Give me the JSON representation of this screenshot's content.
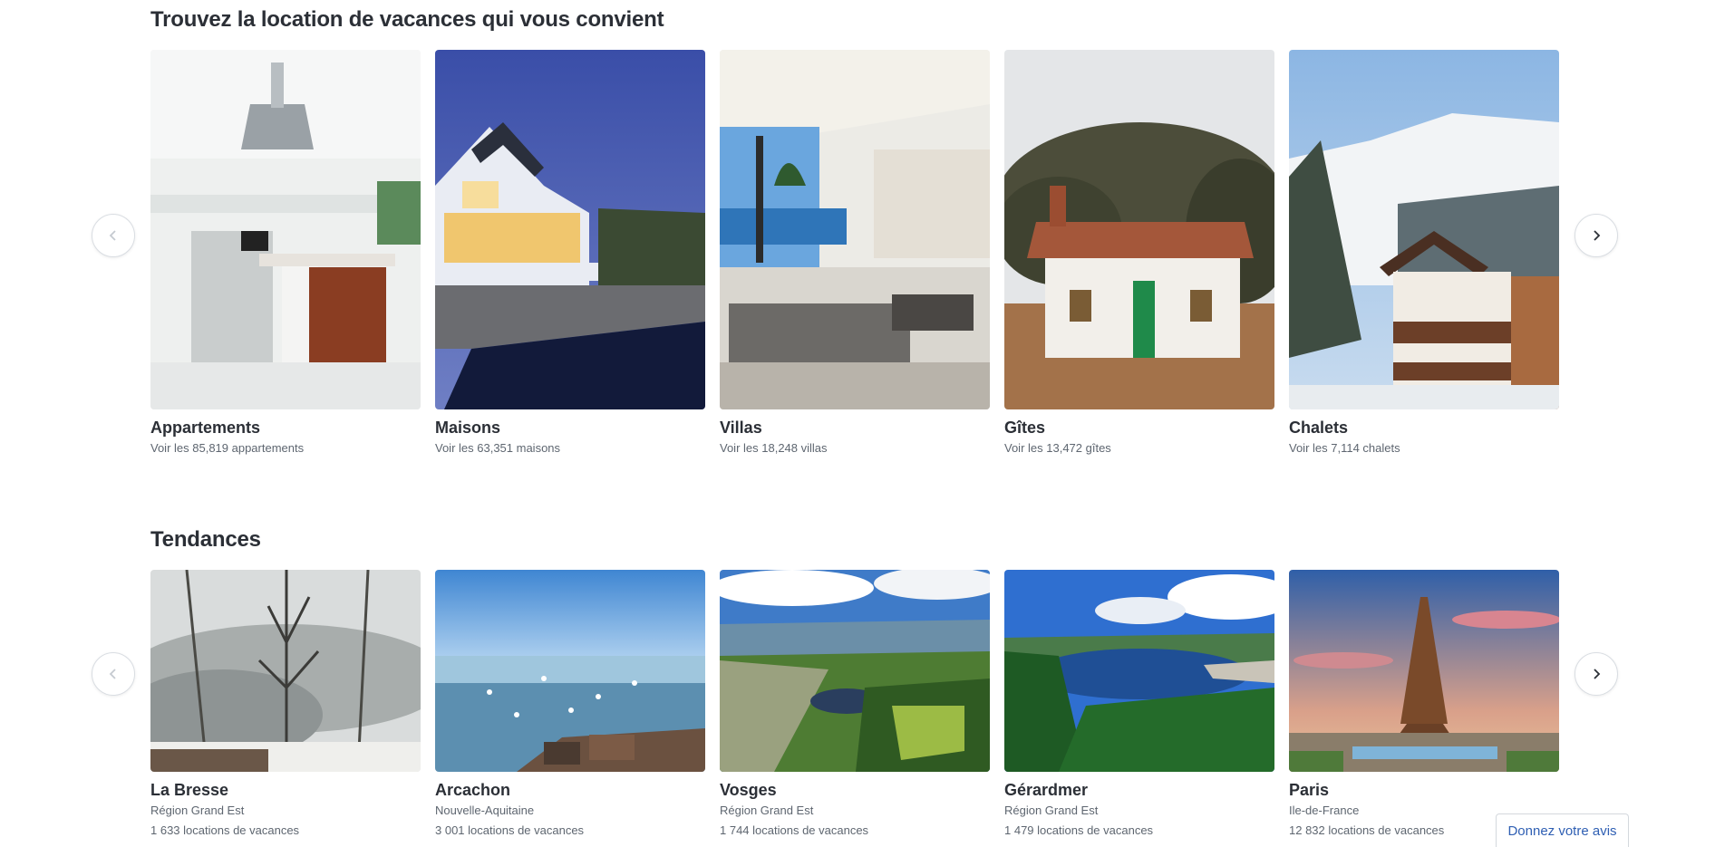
{
  "types_section": {
    "title": "Trouvez la location de vacances qui vous convient",
    "cards": [
      {
        "name": "Appartements",
        "sub": "Voir les 85,819 appartements"
      },
      {
        "name": "Maisons",
        "sub": "Voir les 63,351 maisons"
      },
      {
        "name": "Villas",
        "sub": "Voir les 18,248 villas"
      },
      {
        "name": "Gîtes",
        "sub": "Voir les 13,472 gîtes"
      },
      {
        "name": "Chalets",
        "sub": "Voir les 7,114 chalets"
      }
    ]
  },
  "trending_section": {
    "title": "Tendances",
    "cards": [
      {
        "name": "La Bresse",
        "region": "Région Grand Est",
        "count": "1 633 locations de vacances"
      },
      {
        "name": "Arcachon",
        "region": "Nouvelle-Aquitaine",
        "count": "3 001 locations de vacances"
      },
      {
        "name": "Vosges",
        "region": "Région Grand Est",
        "count": "1 744 locations de vacances"
      },
      {
        "name": "Gérardmer",
        "region": "Région Grand Est",
        "count": "1 479 locations de vacances"
      },
      {
        "name": "Paris",
        "region": "Ile-de-France",
        "count": "12 832 locations de vacances"
      }
    ]
  },
  "feedback": {
    "label": "Donnez votre avis"
  },
  "colors": {
    "accent_link": "#2f5fb3",
    "text": "#2b2f36",
    "muted": "#5e6670"
  }
}
